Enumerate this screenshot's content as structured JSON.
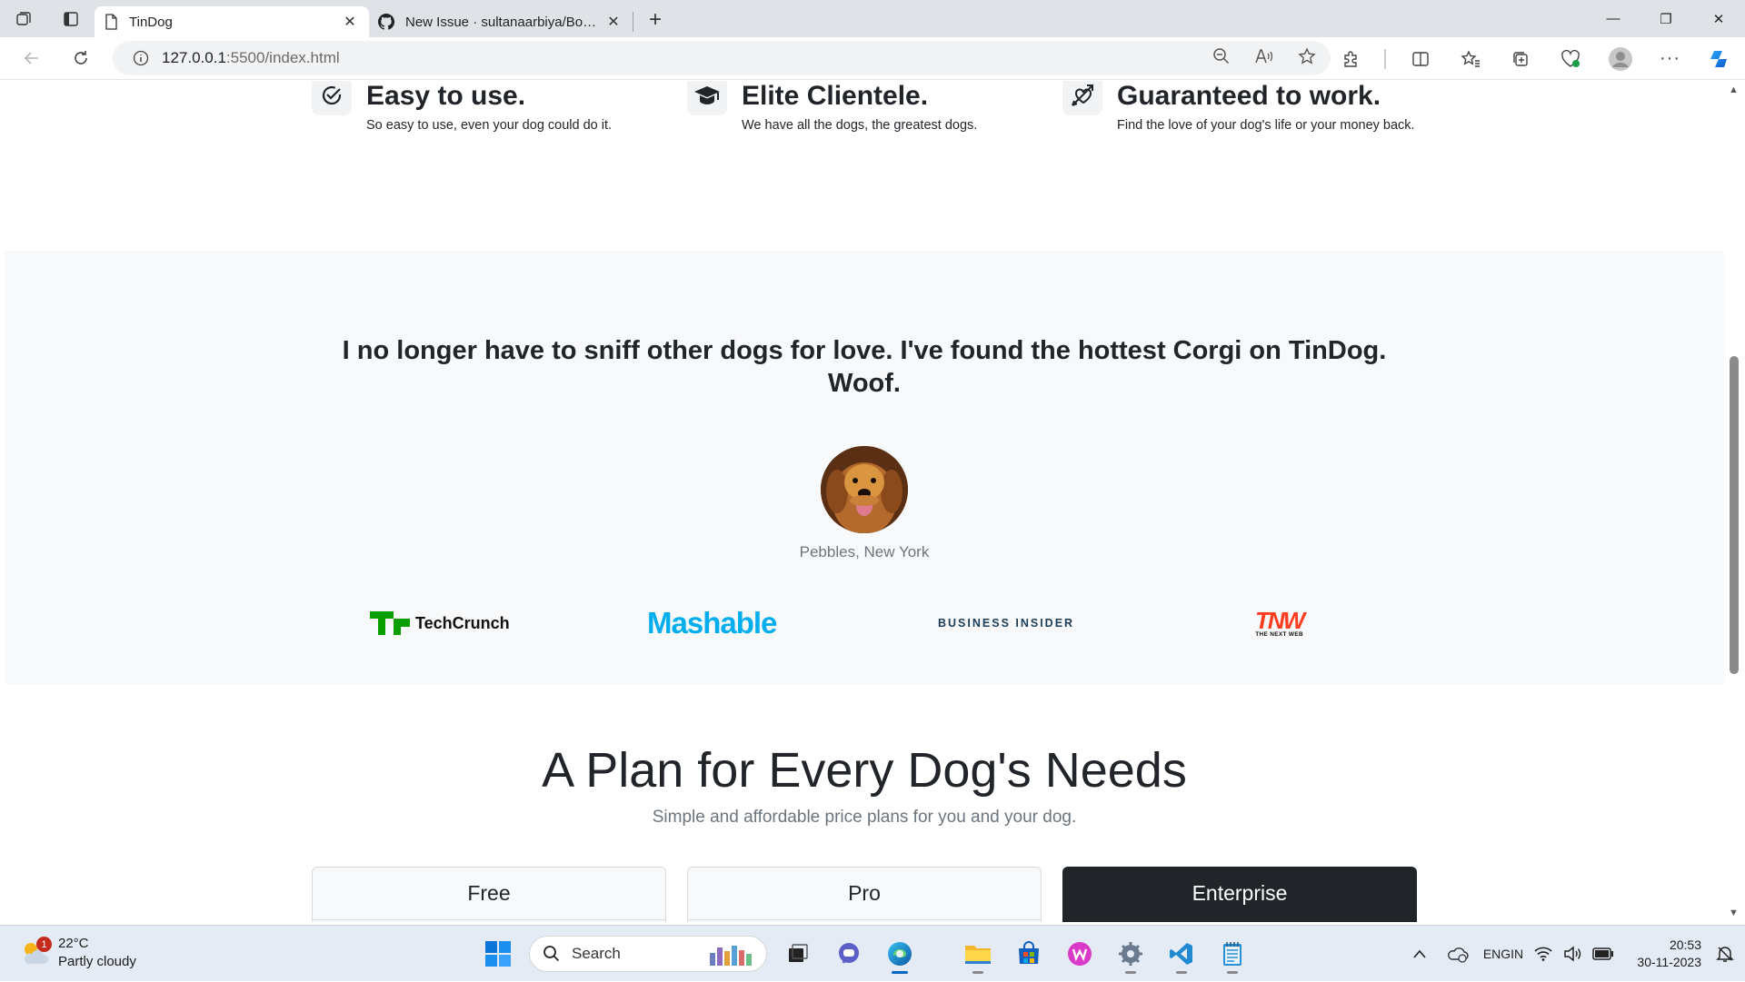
{
  "browser": {
    "tabs": [
      {
        "title": "TinDog",
        "active": true
      },
      {
        "title": "New Issue · sultanaarbiya/Bootst",
        "active": false
      }
    ],
    "url_host": "127.0.0.1",
    "url_path": ":5500/index.html"
  },
  "features": [
    {
      "title": "Easy to use.",
      "text": "So easy to use, even your dog could do it.",
      "icon": "check-circle-icon"
    },
    {
      "title": "Elite Clientele.",
      "text": "We have all the dogs, the greatest dogs.",
      "icon": "graduation-cap-icon"
    },
    {
      "title": "Guaranteed to work.",
      "text": "Find the love of your dog's life or your money back.",
      "icon": "heart-arrow-icon"
    }
  ],
  "testimonial": {
    "quote": "I no longer have to sniff other dogs for love. I've found the hottest Corgi on TinDog. Woof.",
    "author": "Pebbles, New York"
  },
  "press": {
    "techcrunch": "TechCrunch",
    "mashable": "Mashable",
    "business_insider": "BUSINESS INSIDER",
    "tnw": "TNW",
    "tnw_sub": "THE NEXT WEB"
  },
  "pricing": {
    "title": "A Plan for Every Dog's Needs",
    "subtitle": "Simple and affordable price plans for you and your dog.",
    "plans": [
      "Free",
      "Pro",
      "Enterprise"
    ]
  },
  "taskbar": {
    "weather_temp": "22°C",
    "weather_desc": "Partly cloudy",
    "weather_badge": "1",
    "search_label": "Search",
    "lang_1": "ENG",
    "lang_2": "IN",
    "time": "20:53",
    "date": "30-11-2023"
  },
  "colors": {
    "techcrunch": "#0a9e01",
    "mashable": "#00aeef",
    "business_insider": "#1c3d5a",
    "tnw": "#ff3c1f",
    "enterprise_header": "#212529"
  }
}
